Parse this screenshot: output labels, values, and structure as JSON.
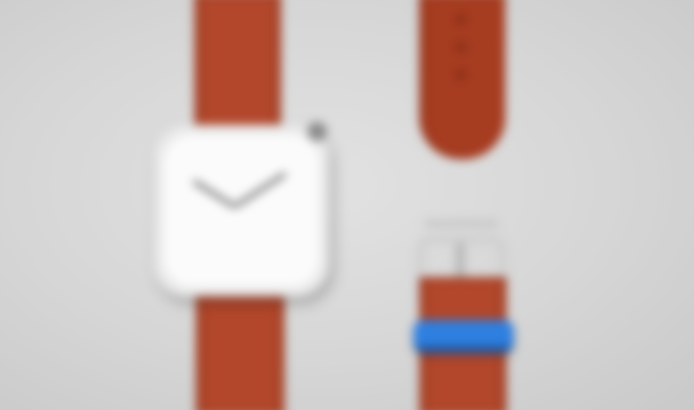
{
  "scene": {
    "description_colors": {
      "background": "#d6d6d6",
      "strap": "#b2472b",
      "watch_case": "#e9e9e9",
      "dial": "#fbfbfb",
      "hands": "#7d7d7d",
      "keeper_band": "#2e7fe0"
    },
    "time_shown": "10:10"
  }
}
